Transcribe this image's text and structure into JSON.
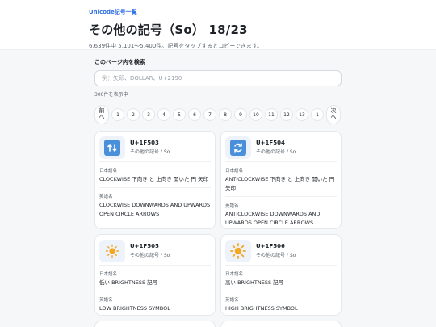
{
  "header": {
    "breadcrumb": "Unicode記号一覧",
    "title": "その他の記号（So） 18/23",
    "subtitle": "6,639件中 5,101〜5,400件。記号をタップするとコピーできます。"
  },
  "search": {
    "label": "このページ内を検索",
    "placeholder": "例：矢印、DOLLAR、U+2190",
    "result_count": "300件を表示中"
  },
  "pagination": {
    "prev_label": "前",
    "prev_arrow": "へ",
    "next_label": "次",
    "next_arrow": "へ",
    "pages": [
      "1",
      "2",
      "3",
      "4",
      "5",
      "6",
      "7",
      "8",
      "9",
      "10",
      "11",
      "12",
      "13",
      "1"
    ]
  },
  "field_labels": {
    "japanese": "日本語名",
    "english": "英語名"
  },
  "cards": [
    {
      "code": "U+1F503",
      "category": "その他の記号 / So",
      "icon": "clockwise-arrows-icon",
      "japanese_name": "CLOCKWISE 下向き と 上向き 開いた 円 矢印",
      "english_name": "CLOCKWISE DOWNWARDS AND UPWARDS OPEN CIRCLE ARROWS"
    },
    {
      "code": "U+1F504",
      "category": "その他の記号 / So",
      "icon": "anticlockwise-arrows-icon",
      "japanese_name": "ANTICLOCKWISE 下向き と 上向き 開いた 円 矢印",
      "english_name": "ANTICLOCKWISE DOWNWARDS AND UPWARDS OPEN CIRCLE ARROWS"
    },
    {
      "code": "U+1F505",
      "category": "その他の記号 / So",
      "icon": "low-brightness-icon",
      "japanese_name": "低い BRIGHTNESS 記号",
      "english_name": "LOW BRIGHTNESS SYMBOL"
    },
    {
      "code": "U+1F506",
      "category": "その他の記号 / So",
      "icon": "high-brightness-icon",
      "japanese_name": "高い BRIGHTNESS 記号",
      "english_name": "HIGH BRIGHTNESS SYMBOL"
    }
  ],
  "colors": {
    "accent": "#2f6fe4",
    "arrow_tile": "#4a8fd9",
    "sun": "#f5a623"
  }
}
